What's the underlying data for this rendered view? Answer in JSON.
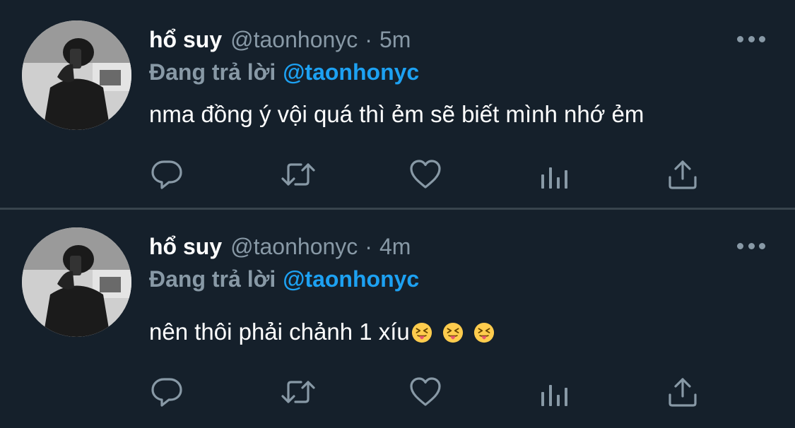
{
  "colors": {
    "background": "#15202b",
    "divider": "#38444d",
    "secondary_text": "#8899a6",
    "accent": "#1da1f2",
    "primary_text": "#ffffff"
  },
  "tweets": [
    {
      "name": "hổ suy",
      "handle": "@taonhonyc",
      "dot": "·",
      "time": "5m",
      "reply_prefix": "Đang trả lời",
      "reply_to": "@taonhonyc",
      "text": "nma đồng ý vội quá thì ẻm sẽ biết mình nhớ ẻm",
      "emojis": [],
      "actions": [
        "reply-icon",
        "retweet-icon",
        "like-icon",
        "analytics-icon",
        "share-icon"
      ]
    },
    {
      "name": "hổ suy",
      "handle": "@taonhonyc",
      "dot": "·",
      "time": "4m",
      "reply_prefix": "Đang trả lời",
      "reply_to": "@taonhonyc",
      "text": "nên thôi phải chảnh 1 xíu",
      "emojis": [
        "squinting-face-with-tongue",
        "squinting-face-with-tongue",
        "squinting-face-with-tongue"
      ],
      "actions": [
        "reply-icon",
        "retweet-icon",
        "like-icon",
        "analytics-icon",
        "share-icon"
      ]
    }
  ]
}
